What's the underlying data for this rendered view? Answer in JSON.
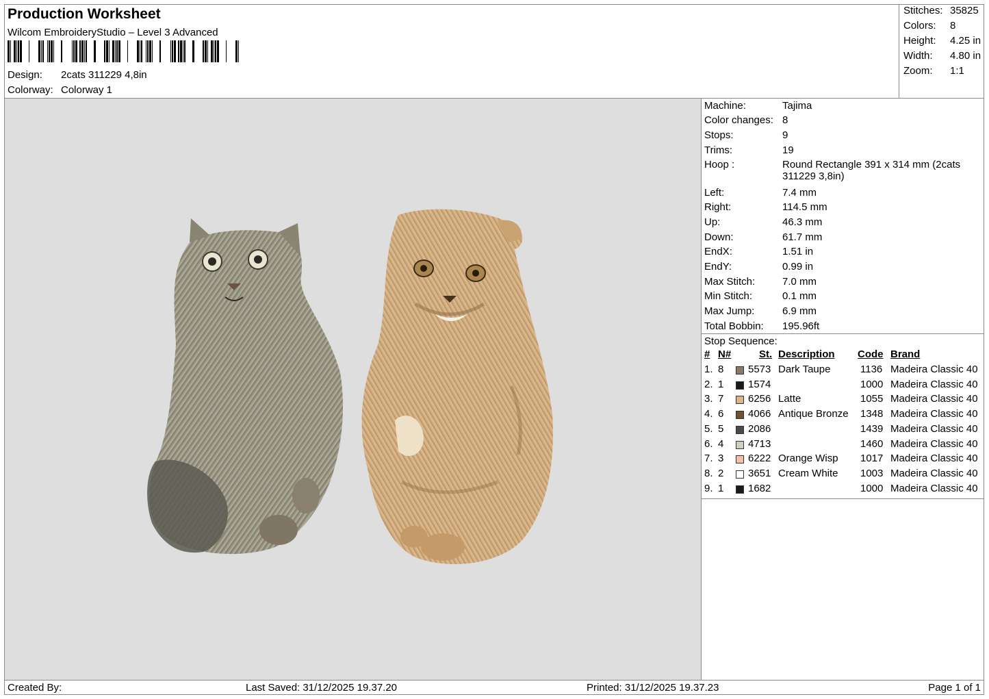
{
  "header": {
    "title": "Production Worksheet",
    "software": "Wilcom EmbroideryStudio – Level 3 Advanced",
    "design_label": "Design:",
    "design_value": "2cats 311229 4,8in",
    "colorway_label": "Colorway:",
    "colorway_value": "Colorway 1"
  },
  "stats": [
    {
      "label": "Stitches:",
      "value": "35825"
    },
    {
      "label": "Colors:",
      "value": "8"
    },
    {
      "label": "Height:",
      "value": "4.25 in"
    },
    {
      "label": "Width:",
      "value": "4.80 in"
    },
    {
      "label": "Zoom:",
      "value": "1:1"
    }
  ],
  "info": [
    {
      "label": "Machine:",
      "value": "Tajima"
    },
    {
      "label": "Color changes:",
      "value": "8"
    },
    {
      "label": "Stops:",
      "value": "9"
    },
    {
      "label": "Trims:",
      "value": "19"
    },
    {
      "label": "Hoop :",
      "value": "Round Rectangle 391 x 314 mm (2cats 311229 3,8in)"
    },
    {
      "label": "Left:",
      "value": "7.4 mm"
    },
    {
      "label": "Right:",
      "value": "114.5 mm"
    },
    {
      "label": "Up:",
      "value": "46.3 mm"
    },
    {
      "label": "Down:",
      "value": "61.7 mm"
    },
    {
      "label": "EndX:",
      "value": "1.51 in"
    },
    {
      "label": "EndY:",
      "value": "0.99 in"
    },
    {
      "label": "Max Stitch:",
      "value": "7.0 mm"
    },
    {
      "label": "Min Stitch:",
      "value": "0.1 mm"
    },
    {
      "label": "Max Jump:",
      "value": "6.9 mm"
    },
    {
      "label": "Total Bobbin:",
      "value": "195.96ft"
    }
  ],
  "stop_sequence": {
    "title": "Stop Sequence:",
    "headers": {
      "num": "#",
      "n": "N#",
      "st": "St.",
      "desc": "Description",
      "code": "Code",
      "brand": "Brand"
    },
    "rows": [
      {
        "num": "1.",
        "n": "8",
        "color": "#8a7a6a",
        "st": "5573",
        "desc": "Dark Taupe",
        "code": "1136",
        "brand": "Madeira Classic 40"
      },
      {
        "num": "2.",
        "n": "1",
        "color": "#1a1a1a",
        "st": "1574",
        "desc": "",
        "code": "1000",
        "brand": "Madeira Classic 40"
      },
      {
        "num": "3.",
        "n": "7",
        "color": "#d8b68a",
        "st": "6256",
        "desc": "Latte",
        "code": "1055",
        "brand": "Madeira Classic 40"
      },
      {
        "num": "4.",
        "n": "6",
        "color": "#6e5232",
        "st": "4066",
        "desc": "Antique Bronze",
        "code": "1348",
        "brand": "Madeira Classic 40"
      },
      {
        "num": "5.",
        "n": "5",
        "color": "#4a4a46",
        "st": "2086",
        "desc": "",
        "code": "1439",
        "brand": "Madeira Classic 40"
      },
      {
        "num": "6.",
        "n": "4",
        "color": "#cfcfc0",
        "st": "4713",
        "desc": "",
        "code": "1460",
        "brand": "Madeira Classic 40"
      },
      {
        "num": "7.",
        "n": "3",
        "color": "#f2c0a8",
        "st": "6222",
        "desc": "Orange Wisp",
        "code": "1017",
        "brand": "Madeira Classic 40"
      },
      {
        "num": "8.",
        "n": "2",
        "color": "#ffffff",
        "st": "3651",
        "desc": "Cream White",
        "code": "1003",
        "brand": "Madeira Classic 40"
      },
      {
        "num": "9.",
        "n": "1",
        "color": "#1a1a1a",
        "st": "1682",
        "desc": "",
        "code": "1000",
        "brand": "Madeira Classic 40"
      }
    ]
  },
  "footer": {
    "created": "Created By:",
    "saved": "Last Saved: 31/12/2025 19.37.20",
    "printed": "Printed: 31/12/2025 19.37.23",
    "page": "Page 1 of 1"
  },
  "colors": {
    "canvas": "#dedede",
    "grey_cat": "#9a9684",
    "ginger_cat": "#d2ad80"
  }
}
